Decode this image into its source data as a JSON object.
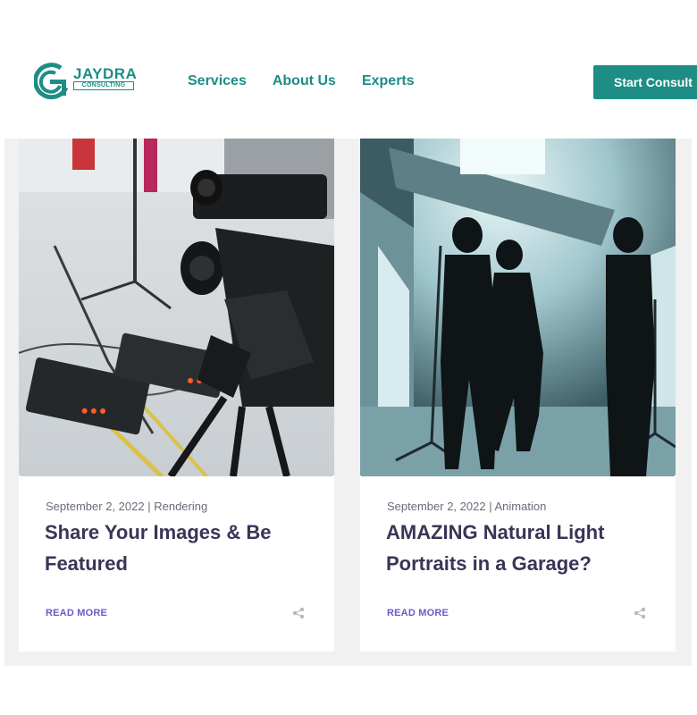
{
  "header": {
    "logo": {
      "name": "JAYDRA",
      "sub": "CONSULTING"
    },
    "nav": [
      {
        "label": "Services"
      },
      {
        "label": "About Us"
      },
      {
        "label": "Experts"
      }
    ],
    "cta_label": "Start Consult"
  },
  "posts": [
    {
      "date": "September 2, 2022",
      "separator": "|",
      "category": "Rendering",
      "title": "Share Your Images & Be Featured",
      "read_more": "READ MORE",
      "share_icon": "share-icon"
    },
    {
      "date": "September 2, 2022",
      "separator": "|",
      "category": "Animation",
      "title": "AMAZING Natural Light Portraits in a Garage?",
      "read_more": "READ MORE",
      "share_icon": "share-icon"
    }
  ],
  "colors": {
    "brand": "#1d8d86",
    "title": "#3a3456",
    "link": "#6a5cc4",
    "background": "#f1f1f1"
  }
}
